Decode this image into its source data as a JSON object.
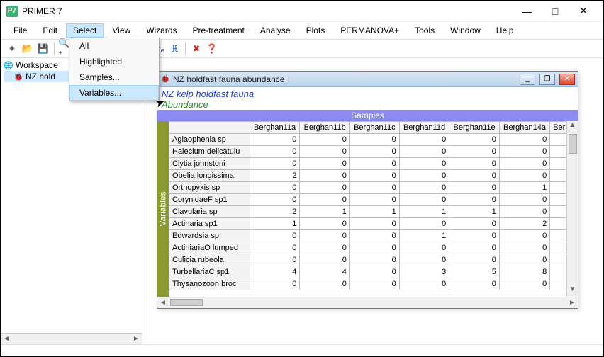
{
  "app": {
    "icon_label": "P7",
    "title": "PRIMER 7"
  },
  "window_controls": {
    "minimize": "—",
    "maximize": "□",
    "close": "✕"
  },
  "menubar": [
    "File",
    "Edit",
    "Select",
    "View",
    "Wizards",
    "Pre-treatment",
    "Analyse",
    "Plots",
    "PERMANOVA+",
    "Tools",
    "Window",
    "Help"
  ],
  "menubar_open_index": 2,
  "select_menu": {
    "items": [
      "All",
      "Highlighted",
      "Samples...",
      "Variables..."
    ],
    "hover_index": 3
  },
  "toolbar_icons": [
    "✦",
    "📂",
    "💾",
    "",
    "🔍⁺",
    "🔍⁻",
    "🔍",
    "🔲",
    "⤢",
    "⇄",
    "ℝₑ",
    "ℝ",
    "",
    "✖",
    "❓"
  ],
  "tree": {
    "root": {
      "icon": "🌐",
      "label": "Workspace"
    },
    "child": {
      "icon": "🐞",
      "label": "NZ holdfast fauna abundance",
      "truncated": "NZ hold"
    }
  },
  "child_window": {
    "icon": "🐞",
    "title": "NZ holdfast fauna abundance",
    "mdi_controls": {
      "minimize": "_",
      "restore": "❐",
      "close": "✕"
    },
    "header_line1": "NZ kelp holdfast fauna",
    "header_line2": "Abundance",
    "samples_label": "Samples",
    "variables_label": "Variables",
    "columns": [
      "Berghan11a",
      "Berghan11b",
      "Berghan11c",
      "Berghan11d",
      "Berghan11e",
      "Berghan14a",
      "Ber"
    ],
    "rows": [
      {
        "name": "Aglaophenia sp",
        "v": [
          0,
          0,
          0,
          0,
          0,
          0
        ]
      },
      {
        "name": "Halecium delicatulu",
        "v": [
          0,
          0,
          0,
          0,
          0,
          0
        ]
      },
      {
        "name": "Clytia johnstoni",
        "v": [
          0,
          0,
          0,
          0,
          0,
          0
        ]
      },
      {
        "name": "Obelia longissima",
        "v": [
          2,
          0,
          0,
          0,
          0,
          0
        ]
      },
      {
        "name": "Orthopyxis sp",
        "v": [
          0,
          0,
          0,
          0,
          0,
          1
        ]
      },
      {
        "name": "CorynidaeF sp1",
        "v": [
          0,
          0,
          0,
          0,
          0,
          0
        ]
      },
      {
        "name": "Clavularia sp",
        "v": [
          2,
          1,
          1,
          1,
          1,
          0
        ]
      },
      {
        "name": "Actinaria sp1",
        "v": [
          1,
          0,
          0,
          0,
          0,
          2
        ]
      },
      {
        "name": "Edwardsia sp",
        "v": [
          0,
          0,
          0,
          1,
          0,
          0
        ]
      },
      {
        "name": "ActiniariaO lumped",
        "v": [
          0,
          0,
          0,
          0,
          0,
          0
        ]
      },
      {
        "name": "Culicia rubeola",
        "v": [
          0,
          0,
          0,
          0,
          0,
          0
        ]
      },
      {
        "name": "TurbellariaC sp1",
        "v": [
          4,
          4,
          0,
          3,
          5,
          8
        ]
      },
      {
        "name": "Thysanozoon broc",
        "v": [
          0,
          0,
          0,
          0,
          0,
          0
        ]
      }
    ]
  }
}
